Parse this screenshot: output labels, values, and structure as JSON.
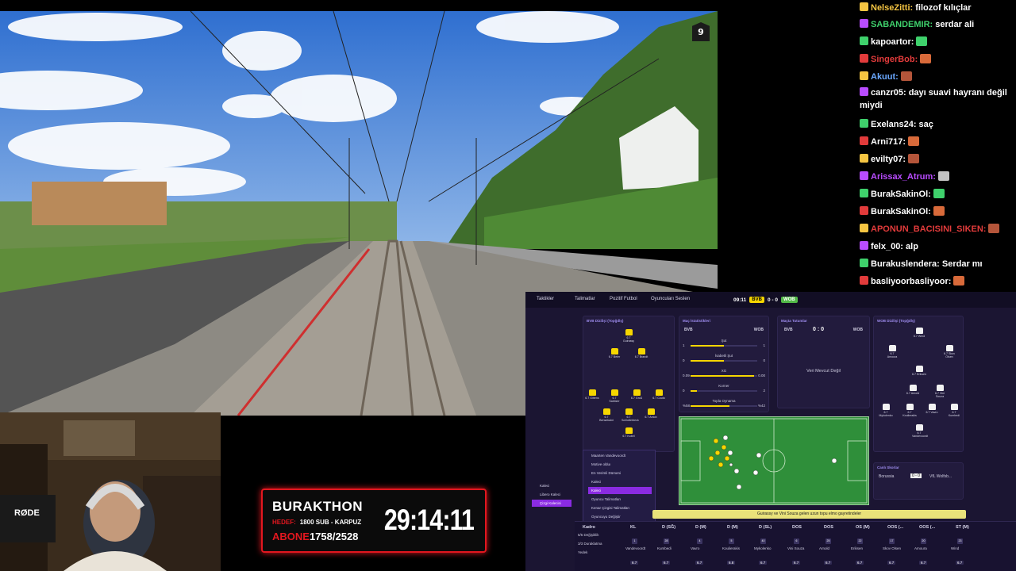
{
  "chat": {
    "messages": [
      {
        "user": "NelseZitti",
        "user_color": "#f5c542",
        "text": "filozof kılıçlar"
      },
      {
        "user": "SABANDEMIR",
        "user_color": "#3fd16c",
        "text": "serdar ali"
      },
      {
        "user": "kapoartor",
        "user_color": "#ffffff",
        "text": ""
      },
      {
        "user": "SingerBob",
        "user_color": "#e23b3b",
        "text": ""
      },
      {
        "user": "Akuut",
        "user_color": "#6aa8ff",
        "text": ""
      },
      {
        "user": "canzr05",
        "user_color": "#ffffff",
        "text": "dayı suavi hayranı değil miydi"
      },
      {
        "user": "Exelans24",
        "user_color": "#ffffff",
        "text": "saç"
      },
      {
        "user": "Arni717",
        "user_color": "#ffffff",
        "text": ""
      },
      {
        "user": "evilty07",
        "user_color": "#ffffff",
        "text": ""
      },
      {
        "user": "Arissax_Atrum",
        "user_color": "#b94cff",
        "text": ""
      },
      {
        "user": "BurakSakinOl",
        "user_color": "#ffffff",
        "text": ""
      },
      {
        "user": "BurakSakinOl",
        "user_color": "#ffffff",
        "text": ""
      },
      {
        "user": "APONUN_BACISINI_SIKEN",
        "user_color": "#e23b3b",
        "text": ""
      },
      {
        "user": "felx_00",
        "user_color": "#ffffff",
        "text": "alp"
      },
      {
        "user": "Burakuslendera",
        "user_color": "#ffffff",
        "text": "Serdar mı"
      },
      {
        "user": "basliyoorbasliyoor",
        "user_color": "#ffffff",
        "text": ""
      }
    ]
  },
  "train_view": {
    "corner_badge": "9"
  },
  "overlay": {
    "title": "BURAKTHON",
    "hedef_label": "HEDEF:",
    "hedef_value": "1800 SUB - KARPUZ",
    "abone_label": "ABONE",
    "abone_value": "1758/2528",
    "timer": "29:14:11"
  },
  "fm": {
    "top_tabs": [
      "Taktikler",
      "Talimatlar",
      "Pozitif Futbol",
      "Oyuncuları Seslen"
    ],
    "match_time": "09:11",
    "home_team": "BVB",
    "away_team": "WOB",
    "score": "0 - 0",
    "home_panel_title": "BVB Dizilişi (Topğdlş)",
    "stats_panel_title": "Maç İstatistikleri",
    "stats_home": "BVB",
    "stats_away": "WOB",
    "stats": [
      {
        "label": "Şut",
        "home": "1",
        "away": "1",
        "home_frac": 0.5
      },
      {
        "label": "İsabetli Şut",
        "home": "0",
        "away": "0",
        "home_frac": 0.5
      },
      {
        "label": "XG",
        "home": "0.09",
        "away": "0.00",
        "home_frac": 0.95
      },
      {
        "label": "Korner",
        "home": "0",
        "away": "2",
        "home_frac": 0.1
      },
      {
        "label": "Topla Oynama",
        "home": "%58",
        "away": "%42",
        "home_frac": 0.58
      }
    ],
    "player_ratings_title": "Maçta Tutumlar",
    "rating_home": "BVB",
    "rating_score": "0 : 0",
    "rating_away": "WOB",
    "no_data": "Veri Mevcut Değil",
    "away_panel_title": "WOB Dizilişi (Topğdlş)",
    "results_title": "Canlı Skorlar",
    "results_home": "Borussia",
    "results_score": "0 - 0",
    "results_away": "VfL Wolfsb...",
    "commentary": "Guirassy ve Vini Souza gelen uzun topu elmo gayretindeler",
    "context_menu": [
      "Maarten Vandevoordt",
      "Motive olduı",
      "En Verimli Dümeni",
      "Kaleci",
      "Kaleci",
      "Oyuncu Talimatları",
      "Kenar Çizgisi Talimatları",
      "Oyuncuyu Değiştir"
    ],
    "context_highlight": 4,
    "sub_menu": [
      "Kaleci",
      "Libero Kaleci",
      "Çizgi Kalecisi"
    ],
    "sub_highlight": 2,
    "lineup_headers": [
      "Kadro",
      "KL",
      "D (SĞ)",
      "D (M)",
      "D (M)",
      "D (SL)",
      "DOS",
      "DOS",
      "OS (M)",
      "OOS (...",
      "OOS (...",
      "ST (M)"
    ],
    "lineup_numbers": [
      "1",
      "28",
      "4",
      "5",
      "40",
      "6",
      "25",
      "22",
      "17",
      "20",
      "23"
    ],
    "lineup_players": [
      "Vandevoordt",
      "Kumbedi",
      "Vavro",
      "Koulierakis",
      "Mykolenko",
      "Vini Souza",
      "Arnold",
      "Eriksen",
      "Skov Olsen",
      "Amoura",
      "Wind"
    ],
    "lineup_ratings": [
      "6.7",
      "6.7",
      "6.7",
      "6.8",
      "6.7",
      "6.7",
      "6.7",
      "6.7",
      "6.7",
      "6.7",
      "6.7"
    ],
    "lineup_left": [
      "5/5 Değişiklik",
      "3/3 Duraklatma",
      "Yedek"
    ],
    "home_players": [
      {
        "name": "Guirassy",
        "rating": "6.7"
      },
      {
        "name": "Beier",
        "rating": "6.7"
      },
      {
        "name": "Brandt",
        "rating": "6.7"
      },
      {
        "name": "Gittens",
        "rating": "6.7"
      },
      {
        "name": "Sabitzer",
        "rating": "6.7"
      },
      {
        "name": "Groß",
        "rating": "6.7"
      },
      {
        "name": "Couto",
        "rating": "6.7"
      },
      {
        "name": "Bensebaini",
        "rating": "6.7"
      },
      {
        "name": "Schlotterbeck",
        "rating": "6.7"
      },
      {
        "name": "Anton",
        "rating": "6.7"
      },
      {
        "name": "Kobel",
        "rating": "6.7"
      }
    ],
    "away_players": [
      {
        "name": "Wind",
        "rating": "6.7"
      },
      {
        "name": "Amoura",
        "rating": "6.7"
      },
      {
        "name": "Skov Olsen",
        "rating": "6.7"
      },
      {
        "name": "Eriksen",
        "rating": "6.7"
      },
      {
        "name": "Arnold",
        "rating": "6.7"
      },
      {
        "name": "Vini Souza",
        "rating": "6.7"
      },
      {
        "name": "Mykolenko",
        "rating": "6.7"
      },
      {
        "name": "Koulierakis",
        "rating": "6.7"
      },
      {
        "name": "Vavro",
        "rating": "6.7"
      },
      {
        "name": "Kumbedi",
        "rating": "6.7"
      },
      {
        "name": "Vandevoordt",
        "rating": "6.7"
      }
    ],
    "webcam_mic": "RØDE"
  }
}
